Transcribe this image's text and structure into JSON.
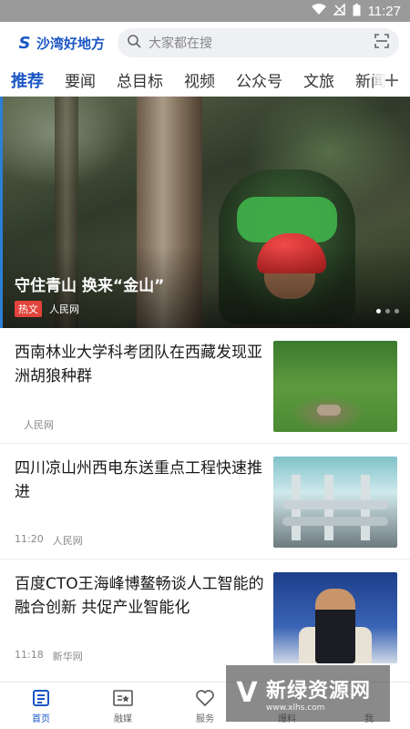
{
  "status_bar": {
    "time": "11:27"
  },
  "header": {
    "logo_text": "沙湾好地方",
    "search_placeholder": "大家都在搜"
  },
  "tabs": [
    {
      "label": "推荐",
      "active": true
    },
    {
      "label": "要闻"
    },
    {
      "label": "总目标"
    },
    {
      "label": "视频"
    },
    {
      "label": "公众号"
    },
    {
      "label": "文旅"
    },
    {
      "label": "新闻"
    }
  ],
  "tabs_add": "+",
  "hero": {
    "title": "守住青山 换来“金山”",
    "badge": "热文",
    "source": "人民网"
  },
  "news": [
    {
      "title": "西南林业大学科考团队在西藏发现亚洲胡狼种群",
      "time": "",
      "source": "人民网"
    },
    {
      "title": "四川凉山州西电东送重点工程快速推进",
      "time": "11:20",
      "source": "人民网"
    },
    {
      "title": "百度CTO王海峰博鳌畅谈人工智能的融合创新 共促产业智能化",
      "time": "11:18",
      "source": "新华网"
    }
  ],
  "bottom_nav": [
    {
      "label": "首页",
      "active": true,
      "icon": "home-news-icon"
    },
    {
      "label": "融媒",
      "icon": "media-icon"
    },
    {
      "label": "服务",
      "icon": "heart-service-icon"
    },
    {
      "label": "爆料",
      "icon": "report-icon"
    },
    {
      "label": "我",
      "icon": "user-icon"
    }
  ],
  "watermark": {
    "title": "新绿资源网",
    "url": "www.xlhs.com"
  },
  "colors": {
    "accent": "#1a56c4",
    "badge": "#e2433a"
  }
}
